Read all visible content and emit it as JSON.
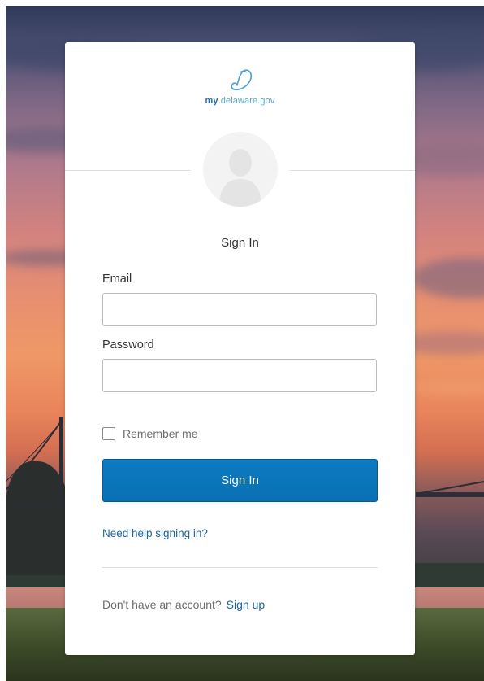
{
  "logo": {
    "glyph": "D",
    "prefix": "my",
    "suffix": ".delaware.gov"
  },
  "avatar": {
    "icon": "user-silhouette-icon"
  },
  "form": {
    "title": "Sign In",
    "email": {
      "label": "Email",
      "value": "",
      "placeholder": ""
    },
    "password": {
      "label": "Password",
      "value": "",
      "placeholder": ""
    },
    "remember_label": "Remember me",
    "remember_checked": false,
    "submit_label": "Sign In"
  },
  "links": {
    "help": "Need help signing in?",
    "no_account": "Don't have an account?",
    "signup": "Sign up"
  },
  "colors": {
    "primary_button": "#0a70b2",
    "link": "#1d65a6",
    "logo_accent": "#5aa9d6"
  }
}
